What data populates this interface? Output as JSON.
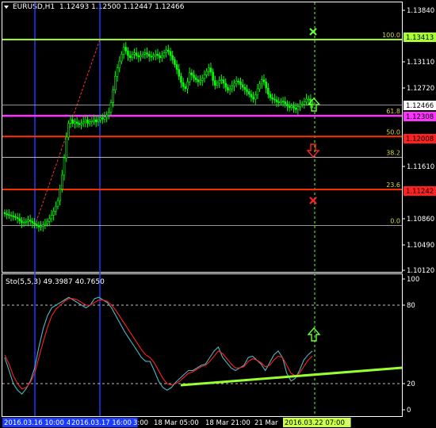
{
  "colors": {
    "background": "#000000",
    "axis": "#ffffff",
    "candle": "#00ff00",
    "vline": "#1a3cff",
    "fib_100": "#aaff33",
    "fib_618": "#ff33ff",
    "fib_500": "#ff3300",
    "fib_236": "#ff3300",
    "fib_plain": "#cccccc",
    "price_tag": "#ffffff",
    "stoch_main": "#4fb8c8",
    "stoch_signal": "#ff2020",
    "trend": "#99ff33",
    "green_marker": "#66ff33",
    "red_marker": "#ff2222"
  },
  "header": {
    "symbol": "EURUSD,H1",
    "ohlc": "1.12493 1.12500 1.12447 1.12466"
  },
  "price_axis": {
    "ticks": [
      "1.13840",
      "1.13110",
      "1.12720",
      "1.12466",
      "1.11610",
      "1.10860",
      "1.10490",
      "1.10120"
    ],
    "tags": [
      {
        "text": "1.13413",
        "color": "#aaff33",
        "text_color": "#000000"
      },
      {
        "text": "1.12466",
        "color": "#ffffff",
        "text_color": "#000000"
      },
      {
        "text": "1.12308",
        "color": "#ff33ff",
        "text_color": "#000000"
      },
      {
        "text": "1.12008",
        "color": "#ff2020",
        "text_color": "#000000"
      },
      {
        "text": "1.11242",
        "color": "#ff2020",
        "text_color": "#000000"
      }
    ]
  },
  "fib_levels": [
    {
      "label": "100.0",
      "price": "1.13413"
    },
    {
      "label": "61.8",
      "price": "1.12308"
    },
    {
      "label": "50.0",
      "price": "1.12008"
    },
    {
      "label": "38.2",
      "price": ""
    },
    {
      "label": "23.6",
      "price": "1.11242"
    },
    {
      "label": "0.0",
      "price": ""
    }
  ],
  "indicator": {
    "title": "Sto(5,5,3) 49.3987 40.7650",
    "ticks": [
      "100",
      "80",
      "20",
      "0"
    ]
  },
  "time_axis": {
    "labels": [
      "2016.03.16 10:00",
      "4",
      "2016.03.17 16:00",
      "3:00",
      "18 Mar 05:00",
      "18 Mar 21:00",
      "21 Mar",
      "2016.03.22 07:00",
      "0"
    ],
    "highlighted": [
      "2016.03.16 10:00",
      "2016.03.17 16:00",
      "2016.03.22 07:00"
    ]
  },
  "chart_data": {
    "type": "candlestick",
    "symbol": "EURUSD",
    "timeframe": "H1",
    "ylim": [
      1.1005,
      1.1395
    ],
    "close_series": [
      1.1089,
      1.1088,
      1.1087,
      1.1086,
      1.1085,
      1.1084,
      1.1082,
      1.1079,
      1.1076,
      1.1077,
      1.1078,
      1.108,
      1.1078,
      1.1076,
      1.1074,
      1.1072,
      1.107,
      1.1071,
      1.1073,
      1.1075,
      1.1078,
      1.1082,
      1.1087,
      1.1093,
      1.11,
      1.1108,
      1.1125,
      1.1145,
      1.117,
      1.12,
      1.122,
      1.1225,
      1.122,
      1.1222,
      1.122,
      1.1218,
      1.122,
      1.1222,
      1.1225,
      1.122,
      1.1222,
      1.1223,
      1.1225,
      1.1222,
      1.1225,
      1.1228,
      1.1226,
      1.1229,
      1.1232,
      1.1236,
      1.125,
      1.1268,
      1.1288,
      1.13,
      1.131,
      1.132,
      1.133,
      1.1325,
      1.1318,
      1.1315,
      1.132,
      1.1322,
      1.1318,
      1.1316,
      1.1318,
      1.132,
      1.1322,
      1.132,
      1.1317,
      1.1316,
      1.1318,
      1.132,
      1.1318,
      1.1315,
      1.1318,
      1.1322,
      1.1326,
      1.1324,
      1.1318,
      1.1312,
      1.1305,
      1.1298,
      1.1288,
      1.1279,
      1.1273,
      1.127,
      1.128,
      1.1293,
      1.129,
      1.1286,
      1.1283,
      1.128,
      1.1282,
      1.1285,
      1.129,
      1.1295,
      1.13,
      1.1294,
      1.1282,
      1.1275,
      1.1278,
      1.1282,
      1.1283,
      1.1278,
      1.1272,
      1.1268,
      1.127,
      1.1274,
      1.1278,
      1.1281,
      1.128,
      1.1276,
      1.1272,
      1.1269,
      1.1266,
      1.1262,
      1.1258,
      1.1255,
      1.1261,
      1.127,
      1.1277,
      1.1283,
      1.128,
      1.1271,
      1.1262,
      1.1257,
      1.1255,
      1.1254,
      1.1251,
      1.125,
      1.1252,
      1.1251,
      1.1248,
      1.1245,
      1.1243,
      1.1245,
      1.1242,
      1.124,
      1.1244,
      1.1247,
      1.1248,
      1.1251,
      1.1255,
      1.1255,
      1.1248,
      1.12466
    ],
    "fib_levels": [
      {
        "ratio": 100.0,
        "price": 1.13413
      },
      {
        "ratio": 61.8,
        "price": 1.12308
      },
      {
        "ratio": 50.0,
        "price": 1.12008
      },
      {
        "ratio": 38.2,
        "price": 1.11708
      },
      {
        "ratio": 23.6,
        "price": 1.11242
      },
      {
        "ratio": 0.0,
        "price": 1.1072
      }
    ],
    "last_price": 1.12466,
    "stochastic": {
      "main": [
        40,
        30,
        20,
        15,
        12,
        16,
        22,
        32,
        48,
        62,
        72,
        78,
        80,
        82,
        84,
        86,
        84,
        82,
        80,
        78,
        80,
        85,
        86,
        84,
        82,
        78,
        72,
        66,
        60,
        55,
        50,
        45,
        40,
        37,
        37,
        30,
        22,
        17,
        15,
        17,
        21,
        24,
        27,
        30,
        30,
        32,
        34,
        35,
        40,
        45,
        48,
        40,
        36,
        32,
        30,
        32,
        34,
        40,
        41,
        38,
        35,
        30,
        36,
        42,
        45,
        40,
        28,
        22,
        24,
        30,
        38,
        42,
        45
      ],
      "signal": [
        42,
        35,
        26,
        20,
        16,
        17,
        21,
        28,
        40,
        52,
        63,
        72,
        77,
        80,
        83,
        85,
        85,
        84,
        82,
        80,
        80,
        82,
        84,
        84,
        83,
        80,
        76,
        71,
        66,
        61,
        56,
        51,
        46,
        42,
        40,
        36,
        30,
        24,
        20,
        19,
        20,
        22,
        25,
        28,
        29,
        31,
        33,
        34,
        37,
        41,
        45,
        43,
        39,
        35,
        32,
        32,
        33,
        37,
        39,
        38,
        36,
        33,
        34,
        38,
        41,
        40,
        34,
        28,
        26,
        28,
        33,
        38,
        41
      ]
    }
  }
}
